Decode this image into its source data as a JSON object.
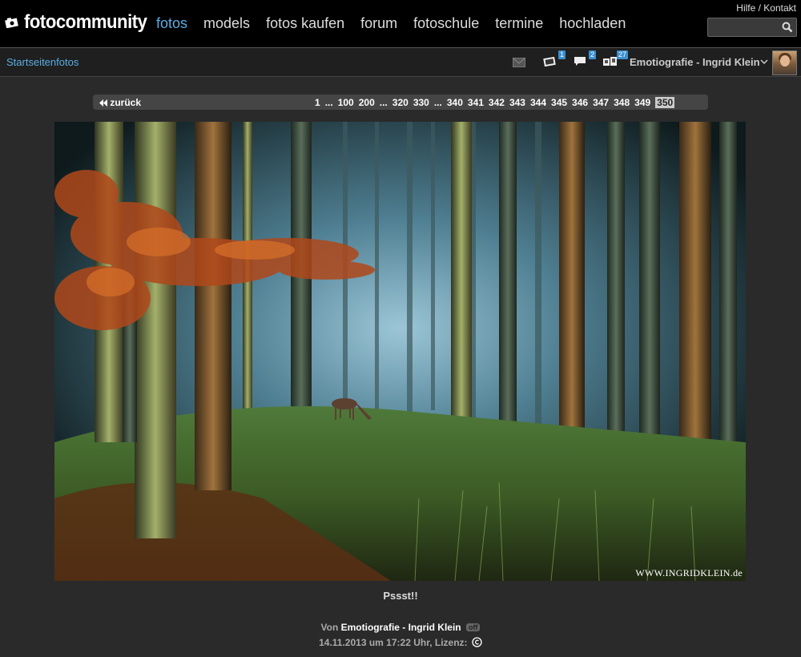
{
  "header": {
    "logo_text": "fotocommunity",
    "nav": [
      {
        "label": "fotos",
        "active": true
      },
      {
        "label": "models",
        "active": false
      },
      {
        "label": "fotos kaufen",
        "active": false
      },
      {
        "label": "forum",
        "active": false
      },
      {
        "label": "fotoschule",
        "active": false
      },
      {
        "label": "termine",
        "active": false
      },
      {
        "label": "hochladen",
        "active": false
      }
    ],
    "help_link": "Hilfe / Kontakt",
    "search": {
      "value": "",
      "icon": "search-icon"
    },
    "accent_color": "#5aaee6"
  },
  "subbar": {
    "section_label": "Startseitenfotos",
    "icons": [
      {
        "name": "mail-icon",
        "count": ""
      },
      {
        "name": "photos-icon",
        "count": "1"
      },
      {
        "name": "comments-icon",
        "count": "2"
      },
      {
        "name": "buddies-icon",
        "count": "27"
      }
    ],
    "user_name": "Emotiografie - Ingrid Klein"
  },
  "pagination": {
    "back_label": "zurück",
    "pages": [
      "1",
      "...",
      "100",
      "200",
      "...",
      "320",
      "330",
      "...",
      "340",
      "341",
      "342",
      "343",
      "344",
      "345",
      "346",
      "347",
      "348",
      "349",
      "350"
    ],
    "current": "350"
  },
  "photo": {
    "watermark": "WWW.INGRIDKLEIN.de",
    "title": "Pssst!!"
  },
  "credit": {
    "by_label": "Von",
    "author": "Emotiografie - Ingrid Klein",
    "status_badge": "off",
    "date": "14.11.2013 um 17:22 Uhr, Lizenz:",
    "license_icon": "copyright-icon"
  }
}
